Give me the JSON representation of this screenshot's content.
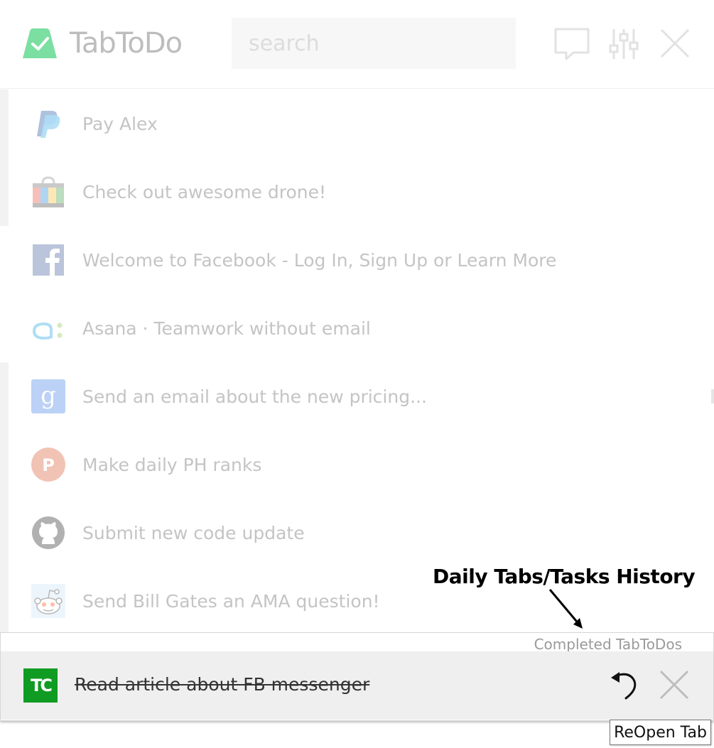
{
  "app": {
    "name": "TabToDo"
  },
  "header": {
    "search_placeholder": "search",
    "icons": [
      "chat-icon",
      "settings-sliders-icon",
      "close-icon"
    ]
  },
  "tabs": [
    {
      "title": "Pay Alex",
      "icon": "paypal-icon"
    },
    {
      "title": "Check out awesome drone!",
      "icon": "shopping-bag-icon"
    },
    {
      "title": "Welcome to Facebook - Log In, Sign Up or Learn More",
      "icon": "facebook-icon"
    },
    {
      "title": "Asana · Teamwork without email",
      "icon": "asana-icon"
    },
    {
      "title": "Send an email about the new pricing...",
      "icon": "google-icon"
    },
    {
      "title": "Make daily PH ranks",
      "icon": "producthunt-icon"
    },
    {
      "title": "Submit new code update",
      "icon": "github-icon"
    },
    {
      "title": "Send Bill Gates an AMA question!",
      "icon": "reddit-icon"
    }
  ],
  "annotation": {
    "text": "Daily Tabs/Tasks History"
  },
  "completed": {
    "label": "Completed TabToDos",
    "items": [
      {
        "title": "Read article about FB messenger",
        "icon": "techcrunch-icon",
        "badge": "TC"
      }
    ]
  },
  "tooltip": {
    "text": "ReOpen Tab"
  },
  "colors": {
    "brand_green": "#2ecc71",
    "techcrunch_green": "#109b22"
  }
}
